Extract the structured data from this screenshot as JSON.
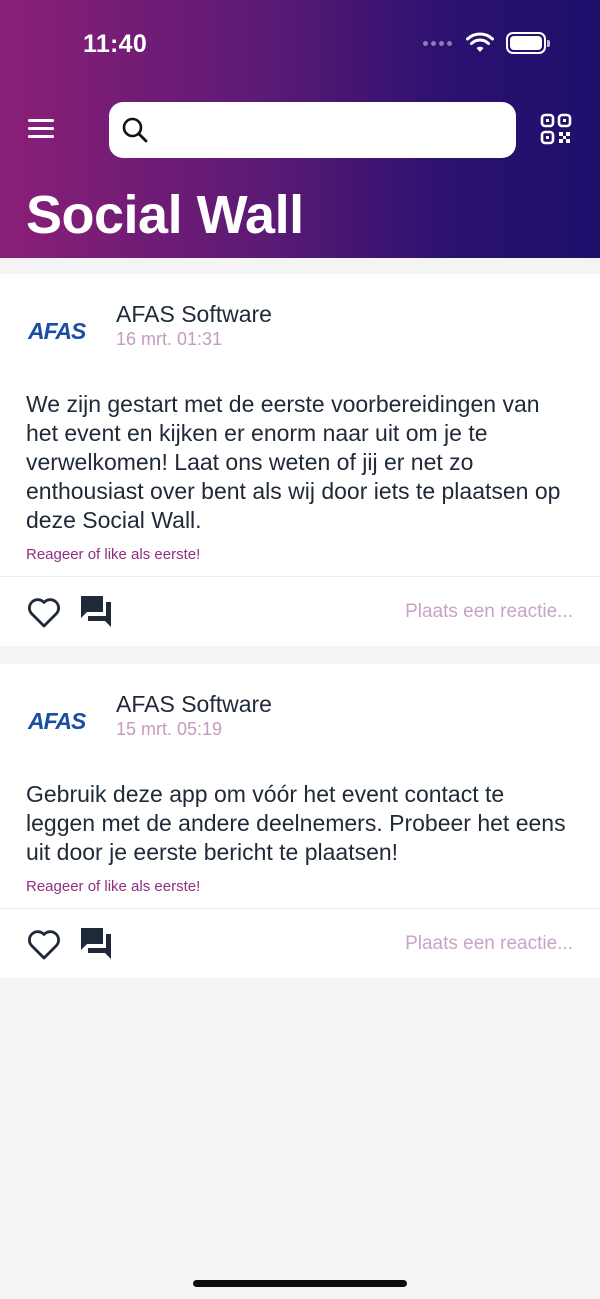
{
  "status_bar": {
    "time": "11:40"
  },
  "header": {
    "title": "Social Wall",
    "search": {
      "placeholder": "",
      "value": ""
    }
  },
  "posts": [
    {
      "author": "AFAS Software",
      "logo_text": "AFAS",
      "date": "16 mrt. 01:31",
      "text": "We zijn gestart met de eerste voorbereidingen van het event en kijken er enorm naar uit om je te verwelkomen! Laat ons weten of jij er net zo enthousiast over bent als wij door iets te plaatsen op deze Social Wall.",
      "reaction_hint": "Reageer of like als eerste!",
      "reply_placeholder": "Plaats een reactie..."
    },
    {
      "author": "AFAS Software",
      "logo_text": "AFAS",
      "date": "15 mrt. 05:19",
      "text": "Gebruik deze app om vóór het event contact te leggen met de andere deelnemers. Probeer het eens uit door je eerste bericht te plaatsen!",
      "reaction_hint": "Reageer of like als eerste!",
      "reply_placeholder": "Plaats een reactie..."
    }
  ],
  "colors": {
    "header_gradient_start": "#8b1f78",
    "header_gradient_end": "#1e0f6b",
    "accent": "#8e2e84",
    "muted_accent": "#c9a3c5",
    "logo_blue": "#1a4ea2"
  },
  "icons": [
    "menu-icon",
    "search-icon",
    "qr-code-icon",
    "heart-icon",
    "comment-icon",
    "wifi-icon",
    "battery-icon"
  ]
}
